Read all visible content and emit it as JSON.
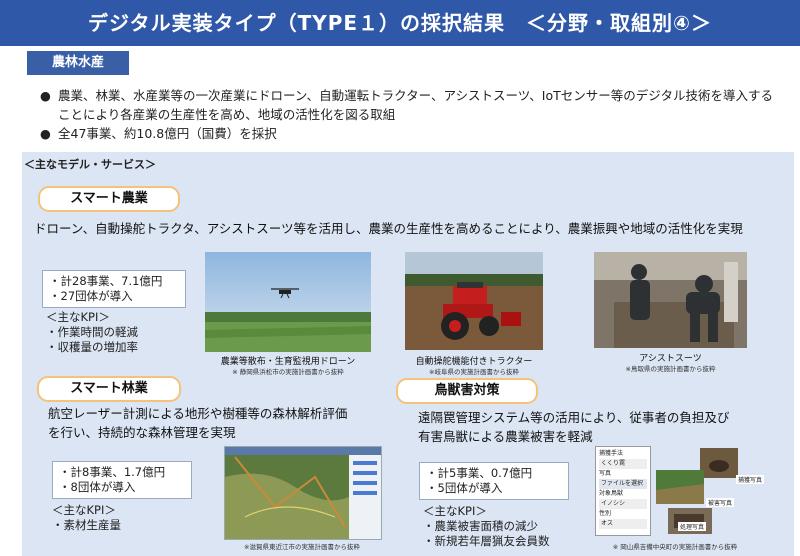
{
  "title": "デジタル実装タイプ（TYPE１）の採択結果　＜分野・取組別④＞",
  "category": "農林水産",
  "bullets": [
    "農業、林業、水産業等の一次産業にドローン、自動運転トラクター、アシストスーツ、IoTセンサー等のデジタル技術を導入する",
    "ことにより各産業の生産性を高め、地域の活性化を図る取組",
    "全47事業、約10.8億円（国費）を採択"
  ],
  "bullet_symbol": "●",
  "panel_heading": "＜主なモデル・サービス＞",
  "smart_agri": {
    "label": "スマート農業",
    "desc": "ドローン、自動操舵トラクタ、アシストスーツ等を活用し、農業の生産性を高めることにより、農業振興や地域の活性化を実現",
    "stats": [
      "・計28事業、7.1億円",
      "・27団体が導入"
    ],
    "kpi_title": "＜主なKPI＞",
    "kpis": [
      "・作業時間の軽減",
      "・収穫量の増加率"
    ],
    "photos": [
      {
        "caption": "農業等散布・生育監視用ドローン",
        "source": "※ 静岡県浜松市の実施計画書から抜粋"
      },
      {
        "caption": "自動操舵機能付きトラクター",
        "source": "※岐阜県の実施計画書から抜粋"
      },
      {
        "caption": "アシストスーツ",
        "source": "※鳥取県の実施計画書から抜粋"
      }
    ]
  },
  "smart_forest": {
    "label": "スマート林業",
    "desc_lines": [
      "航空レーザー計測による地形や樹種等の森林解析評価",
      "を行い、持続的な森林管理を実現"
    ],
    "stats": [
      "・計8事業、1.7億円",
      "・8団体が導入"
    ],
    "kpi_title": "＜主なKPI＞",
    "kpis": [
      "・素材生産量"
    ],
    "photo_source": "※滋賀県東近江市の実施計画書から抜粋"
  },
  "wildlife": {
    "label": "鳥獣害対策",
    "desc_lines": [
      "遠隔罠管理システム等の活用により、従事者の負担及び",
      "有害鳥獣による農業被害を軽減"
    ],
    "stats": [
      "・計5事業、0.7億円",
      "・5団体が導入"
    ],
    "kpi_title": "＜主なKPI＞",
    "kpis": [
      "・農業被害面積の減少",
      "・新規若年層猟友会員数"
    ],
    "form_labels": [
      "捕獲手法",
      "くくり罠",
      "写真",
      "ファイルを選択",
      "対象鳥獣",
      "イノシシ",
      "性別",
      "オス"
    ],
    "photo_tags": [
      "捕獲写真",
      "被害写真",
      "処理写真"
    ],
    "photo_source": "※ 岡山県吉備中央町の実施計画書から抜粋"
  },
  "colors": {
    "title_bg": "#2f58a8",
    "panel_bg": "#dbe5f3",
    "pill_border": "#f4c27a"
  }
}
